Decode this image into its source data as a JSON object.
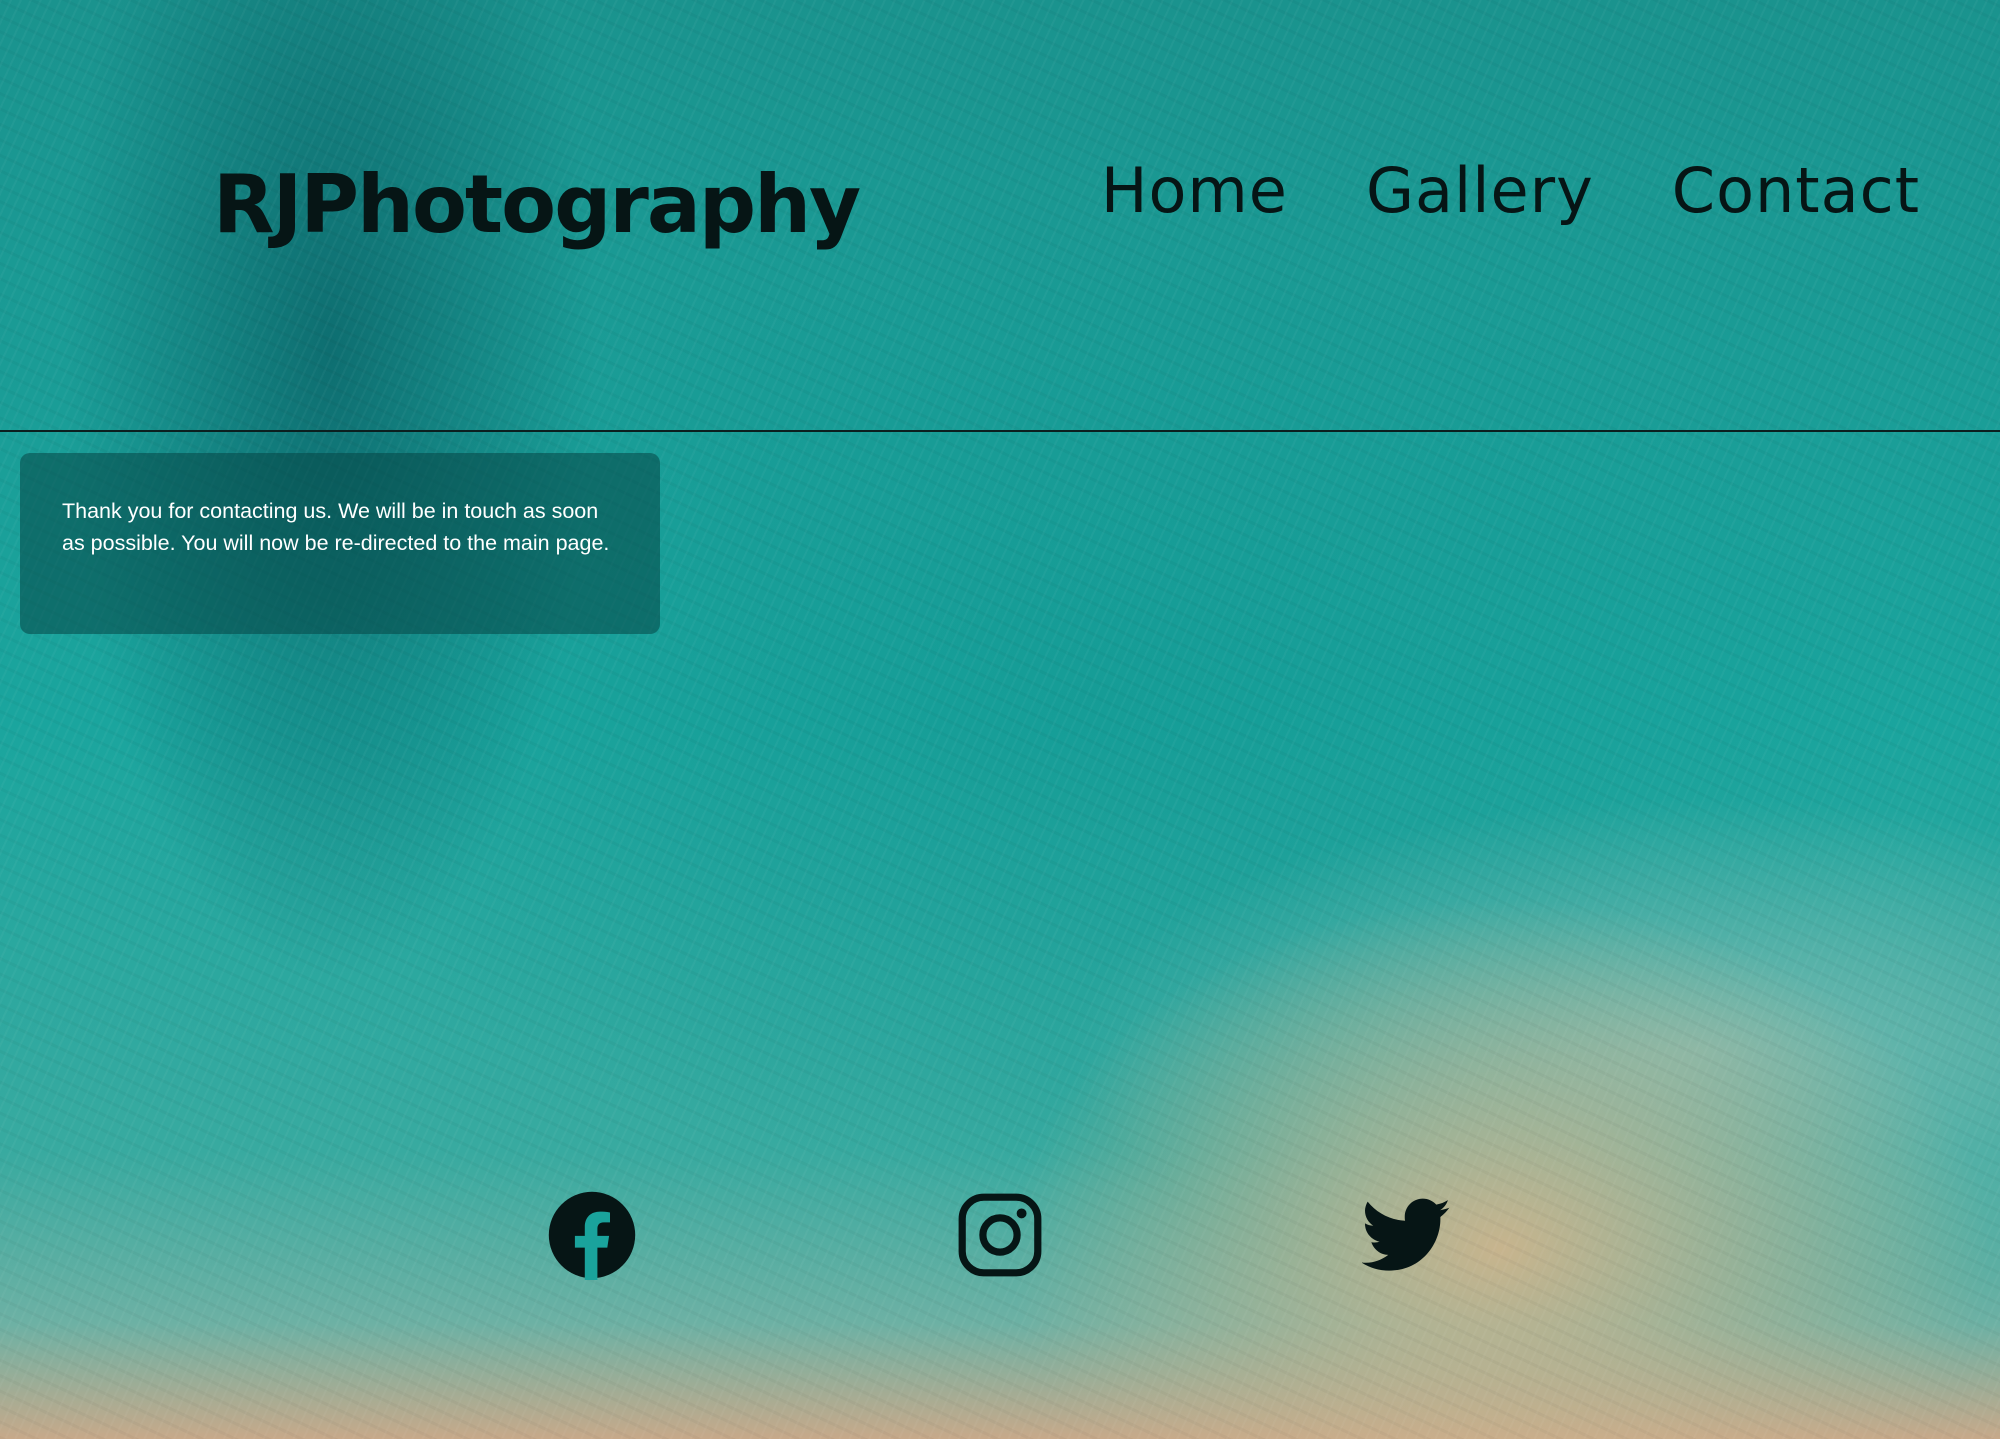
{
  "site": {
    "title": "RJPhotography"
  },
  "nav": {
    "items": [
      {
        "label": "Home"
      },
      {
        "label": "Gallery"
      },
      {
        "label": "Contact"
      }
    ]
  },
  "message": {
    "text": "Thank you for contacting us. We will be in touch as soon as possible. You will now be re-directed to the main page."
  },
  "social": {
    "icons": [
      "facebook-icon",
      "instagram-icon",
      "twitter-icon"
    ]
  },
  "colors": {
    "text_dark": "#061515",
    "background_teal": "#1aa59e",
    "message_text": "#ffffff"
  }
}
